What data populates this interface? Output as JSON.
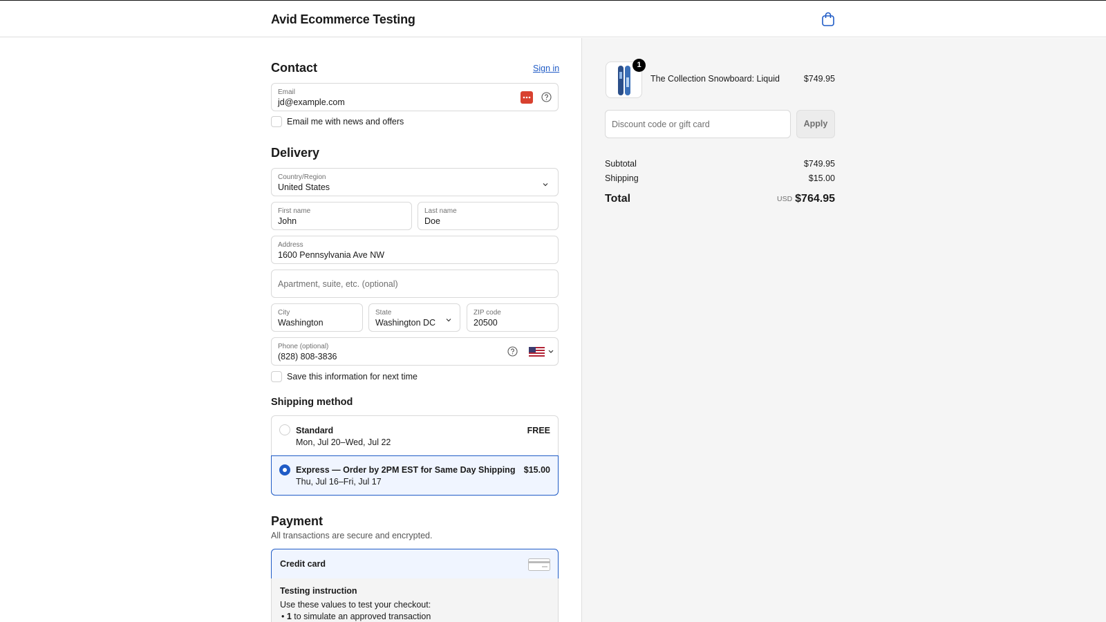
{
  "header": {
    "brand": "Avid Ecommerce Testing",
    "cart_icon": "shopping-bag-icon"
  },
  "contact": {
    "heading": "Contact",
    "sign_in": "Sign in",
    "email_label": "Email",
    "email_value": "jd@example.com",
    "newsletter_label": "Email me with news and offers"
  },
  "delivery": {
    "heading": "Delivery",
    "country_label": "Country/Region",
    "country_value": "United States",
    "first_name_label": "First name",
    "first_name_value": "John",
    "last_name_label": "Last name",
    "last_name_value": "Doe",
    "address_label": "Address",
    "address_value": "1600 Pennsylvania Ave NW",
    "apartment_placeholder": "Apartment, suite, etc. (optional)",
    "city_label": "City",
    "city_value": "Washington",
    "state_label": "State",
    "state_value": "Washington DC",
    "zip_label": "ZIP code",
    "zip_value": "20500",
    "phone_label": "Phone (optional)",
    "phone_value": "(828) 808-3836",
    "save_info_label": "Save this information for next time"
  },
  "shipping": {
    "heading": "Shipping method",
    "options": [
      {
        "title": "Standard",
        "dates": "Mon, Jul 20–Wed, Jul 22",
        "price": "FREE",
        "selected": false
      },
      {
        "title": "Express — Order by 2PM EST for Same Day Shipping",
        "dates": "Thu, Jul 16–Fri, Jul 17",
        "price": "$15.00",
        "selected": true
      }
    ]
  },
  "payment": {
    "heading": "Payment",
    "subtitle": "All transactions are secure and encrypted.",
    "method": "Credit card",
    "testing_heading": "Testing instruction",
    "testing_text": "Use these values to test your checkout:",
    "bullet_bold": "1",
    "bullet_text": " to simulate an approved transaction"
  },
  "summary": {
    "product_name": "The Collection Snowboard: Liquid",
    "product_price": "$749.95",
    "quantity": "1",
    "discount_placeholder": "Discount code or gift card",
    "apply_label": "Apply",
    "subtotal_label": "Subtotal",
    "subtotal_value": "$749.95",
    "shipping_label": "Shipping",
    "shipping_value": "$15.00",
    "total_label": "Total",
    "currency": "USD",
    "total_value": "$764.95"
  },
  "colors": {
    "accent": "#1f5bc6",
    "panel_bg": "#f5f5f5"
  }
}
